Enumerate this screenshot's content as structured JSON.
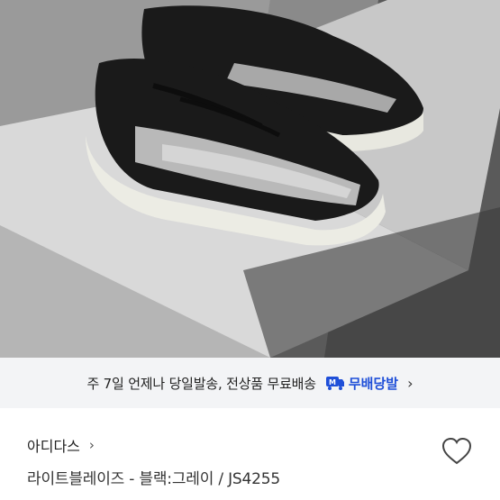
{
  "product_image": {
    "icon": "sneaker-photo"
  },
  "shipping_banner": {
    "text": "주 7일 언제나 당일발송, 전상품 무료배송",
    "badge_label": "무배당발",
    "badge_icon": "m-truck-icon",
    "chevron": "›",
    "accent_color": "#1f4fd8"
  },
  "product": {
    "brand": "아디다스",
    "brand_chevron": "›",
    "title": "라이트블레이즈 - 블랙:그레이 / JS4255"
  },
  "wishlist": {
    "icon": "heart-icon"
  }
}
